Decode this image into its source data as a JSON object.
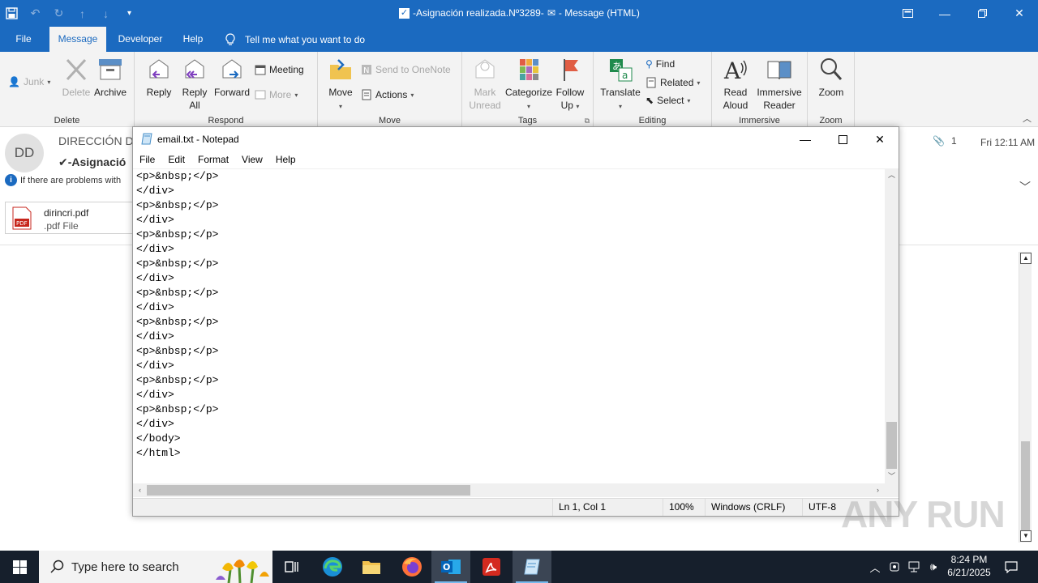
{
  "outlook": {
    "title": "-Asignación realizada.Nº3289-",
    "title_suffix": " -  Message (HTML)",
    "tabs": [
      "File",
      "Message",
      "Developer",
      "Help"
    ],
    "tell_me": "Tell me what you want to do",
    "groups": {
      "delete": {
        "label": "Delete",
        "junk": "Junk",
        "delete": "Delete",
        "archive": "Archive"
      },
      "respond": {
        "label": "Respond",
        "reply": "Reply",
        "reply_all_1": "Reply",
        "reply_all_2": "All",
        "forward": "Forward",
        "meeting": "Meeting",
        "more": "More"
      },
      "move": {
        "label": "Move",
        "move": "Move",
        "send_onenote": "Send to OneNote",
        "actions": "Actions"
      },
      "tags": {
        "label": "Tags",
        "mark_unread_1": "Mark",
        "mark_unread_2": "Unread",
        "categorize": "Categorize",
        "follow_up_1": "Follow",
        "follow_up_2": "Up"
      },
      "editing": {
        "label": "Editing",
        "translate": "Translate",
        "find": "Find",
        "related": "Related",
        "select": "Select"
      },
      "immersive": {
        "label": "Immersive",
        "read_aloud_1": "Read",
        "read_aloud_2": "Aloud",
        "immersive_reader_1": "Immersive",
        "immersive_reader_2": "Reader"
      },
      "zoom": {
        "label": "Zoom",
        "zoom": "Zoom"
      }
    },
    "message": {
      "avatar_initials": "DD",
      "sender": "DIRECCIÓN D",
      "subject": "✔-Asignació",
      "info": "If there are problems with",
      "attachment_name": "dirincri.pdf",
      "attachment_type": ".pdf File",
      "attachment_count": "1",
      "date": "Fri 12:11 AM"
    }
  },
  "notepad": {
    "title": "email.txt - Notepad",
    "menu": [
      "File",
      "Edit",
      "Format",
      "View",
      "Help"
    ],
    "lines": [
      "<p>&nbsp;</p>",
      "</div>",
      "<p>&nbsp;</p>",
      "</div>",
      "<p>&nbsp;</p>",
      "</div>",
      "<p>&nbsp;</p>",
      "</div>",
      "<p>&nbsp;</p>",
      "</div>",
      "<p>&nbsp;</p>",
      "</div>",
      "<p>&nbsp;</p>",
      "</div>",
      "<p>&nbsp;</p>",
      "</div>",
      "<p>&nbsp;</p>",
      "</div>",
      "</body>",
      "</html>"
    ],
    "status": {
      "position": "Ln 1, Col 1",
      "zoom": "100%",
      "line_ending": "Windows (CRLF)",
      "encoding": "UTF-8"
    }
  },
  "taskbar": {
    "search_placeholder": "Type here to search",
    "time": "8:24 PM",
    "date": "6/21/2025"
  },
  "watermark": "ANY RUN"
}
